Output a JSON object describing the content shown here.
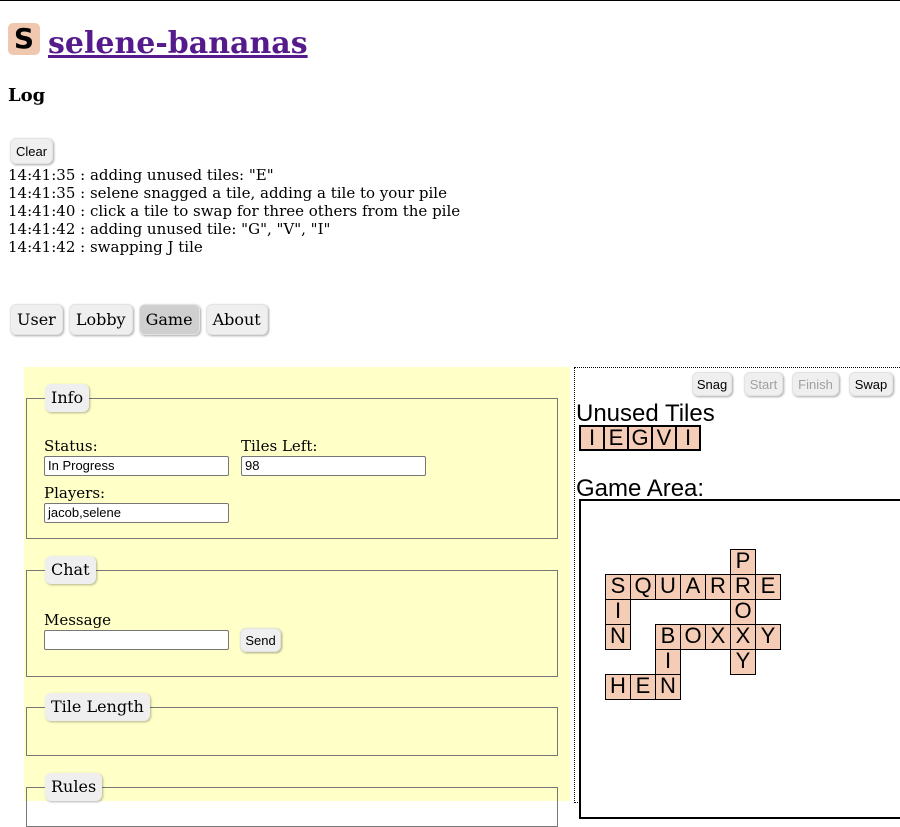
{
  "header": {
    "logo_letter": "S",
    "title": "selene-bananas"
  },
  "log": {
    "heading": "Log",
    "clear_label": "Clear",
    "lines": [
      "14:41:35 : adding unused tiles: \"E\"",
      "14:41:35 : selene snagged a tile, adding a tile to your pile",
      "14:41:40 : click a tile to swap for three others from the pile",
      "14:41:42 : adding unused tile: \"G\", \"V\", \"I\"",
      "14:41:42 : swapping J tile"
    ]
  },
  "tabs": [
    {
      "label": "User",
      "active": false
    },
    {
      "label": "Lobby",
      "active": false
    },
    {
      "label": "Game",
      "active": true
    },
    {
      "label": "About",
      "active": false
    }
  ],
  "info": {
    "legend": "Info",
    "status_label": "Status:",
    "status_value": "In Progress",
    "tiles_left_label": "Tiles Left:",
    "tiles_left_value": "98",
    "players_label": "Players:",
    "players_value": "jacob,selene"
  },
  "chat": {
    "legend": "Chat",
    "message_label": "Message",
    "message_value": "",
    "send_label": "Send"
  },
  "tile_length": {
    "legend": "Tile Length"
  },
  "rules": {
    "legend": "Rules"
  },
  "controls": {
    "snag_label": "Snag",
    "start_label": "Start",
    "finish_label": "Finish",
    "swap_label": "Swap"
  },
  "unused_tiles": {
    "title": "Unused Tiles",
    "tiles": [
      "I",
      "E",
      "G",
      "V",
      "I"
    ]
  },
  "game_area": {
    "title": "Game Area:",
    "tiles": [
      {
        "letter": "P",
        "col": 5,
        "row": 0
      },
      {
        "letter": "S",
        "col": 0,
        "row": 1
      },
      {
        "letter": "Q",
        "col": 1,
        "row": 1
      },
      {
        "letter": "U",
        "col": 2,
        "row": 1
      },
      {
        "letter": "A",
        "col": 3,
        "row": 1
      },
      {
        "letter": "R",
        "col": 4,
        "row": 1
      },
      {
        "letter": "R",
        "col": 5,
        "row": 1
      },
      {
        "letter": "E",
        "col": 6,
        "row": 1
      },
      {
        "letter": "I",
        "col": 0,
        "row": 2
      },
      {
        "letter": "O",
        "col": 5,
        "row": 2
      },
      {
        "letter": "N",
        "col": 0,
        "row": 3
      },
      {
        "letter": "B",
        "col": 2,
        "row": 3
      },
      {
        "letter": "O",
        "col": 3,
        "row": 3
      },
      {
        "letter": "X",
        "col": 4,
        "row": 3
      },
      {
        "letter": "X",
        "col": 5,
        "row": 3
      },
      {
        "letter": "Y",
        "col": 6,
        "row": 3
      },
      {
        "letter": "I",
        "col": 2,
        "row": 4
      },
      {
        "letter": "Y",
        "col": 5,
        "row": 4
      },
      {
        "letter": "H",
        "col": 0,
        "row": 5
      },
      {
        "letter": "E",
        "col": 1,
        "row": 5
      },
      {
        "letter": "N",
        "col": 2,
        "row": 5
      }
    ]
  }
}
